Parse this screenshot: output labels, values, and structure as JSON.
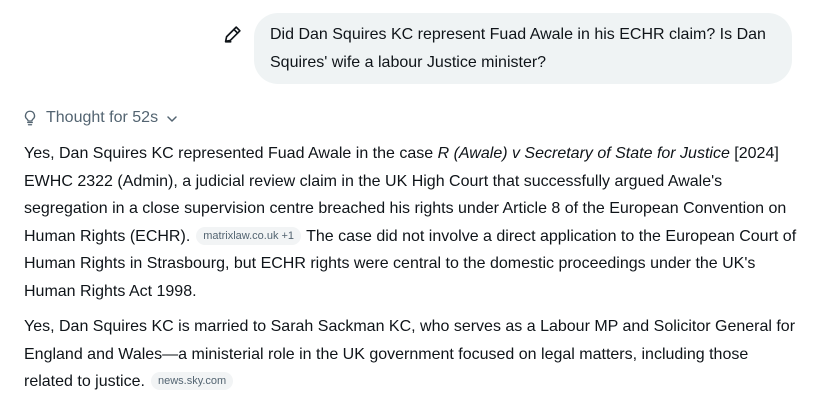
{
  "user_message": {
    "text": "Did Dan Squires KC represent Fuad Awale in his ECHR claim? Is Dan Squires' wife a labour Justice minister?"
  },
  "thought": {
    "label": "Thought for 52s"
  },
  "answer": {
    "p1": {
      "before_case": "Yes, Dan Squires KC represented Fuad Awale in the case ",
      "case_name": "R (Awale) v Secretary of State for Justice",
      "after_case": " [2024] EWHC 2322 (Admin), a judicial review claim in the UK High Court that successfully argued Awale's segregation in a close supervision centre breached his rights under Article 8 of the European Convention on Human Rights (ECHR).",
      "source_chip": "matrixlaw.co.uk +1",
      "after_chip": "The case did not involve a direct application to the European Court of Human Rights in Strasbourg, but ECHR rights were central to the domestic proceedings under the UK's Human Rights Act 1998."
    },
    "p2": {
      "text": "Yes, Dan Squires KC is married to Sarah Sackman KC, who serves as a Labour MP and Solicitor General for England and Wales—a ministerial role in the UK government focused on legal matters, including those related to justice.",
      "source_chip": "news.sky.com"
    }
  },
  "icons": {
    "edit": "pencil-edit-icon",
    "thought": "lightbulb-icon",
    "expand": "chevron-down-icon"
  },
  "colors": {
    "bubble_bg": "#eff3f4",
    "text": "#0f1419",
    "muted": "#536471",
    "chip_bg": "#f2f4f5"
  }
}
